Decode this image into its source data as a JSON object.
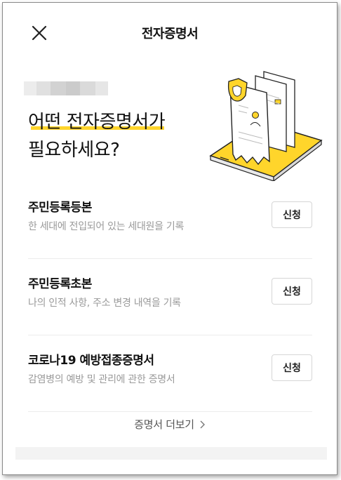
{
  "header": {
    "title": "전자증명서"
  },
  "hero": {
    "line1": "어떤 전자증명서가",
    "line2": "필요하세요?",
    "accent_color": "#ffd52b"
  },
  "documents": [
    {
      "name": "주민등록등본",
      "desc": "한 세대에 전입되어 있는 세대원을 기록",
      "button": "신청"
    },
    {
      "name": "주민등록초본",
      "desc": "나의 인적 사항, 주소 변경 내역을 기록",
      "button": "신청"
    },
    {
      "name": "코로나19 예방접종증명서",
      "desc": "감염병의 예방 및 관리에 관한 증명서",
      "button": "신청"
    }
  ],
  "more": {
    "label": "증명서 더보기"
  }
}
